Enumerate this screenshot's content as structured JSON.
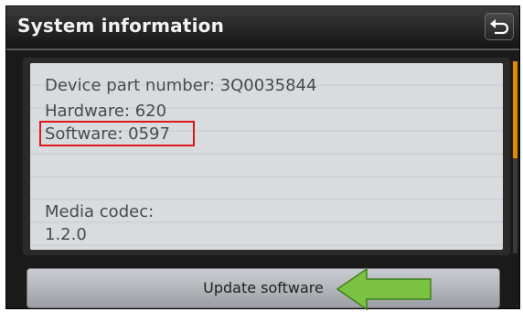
{
  "header": {
    "title": "System information",
    "back_icon": "back-arrow-icon"
  },
  "info": {
    "device_part_number": "Device part number: 3Q0035844",
    "hardware": "Hardware: 620",
    "software": "Software: 0597",
    "media_codec_label": "Media codec:",
    "media_codec_value": "1.2.0"
  },
  "footer": {
    "update_label": "Update software"
  },
  "annotations": {
    "highlight_color": "#e0161b",
    "arrow_color": "#7cc242",
    "arrow_icon": "left-arrow-icon"
  },
  "colors": {
    "scroll_thumb": "#e08a00"
  }
}
